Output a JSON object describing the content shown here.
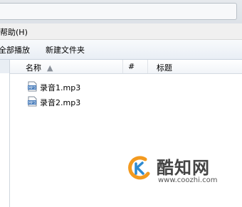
{
  "menubar": {
    "help_label": "帮助(H)"
  },
  "toolbar": {
    "play_all_label": "全部播放",
    "new_folder_label": "新建文件夹"
  },
  "columns": {
    "name_label": "名称",
    "number_label": "#",
    "title_label": "标题"
  },
  "files": [
    {
      "name": "录音1.mp3",
      "icon": "mp3-file-icon"
    },
    {
      "name": "录音2.mp3",
      "icon": "mp3-file-icon"
    }
  ],
  "watermark": {
    "brand": "酷知网",
    "url": "www.coozhi.com"
  },
  "colors": {
    "logo_orange": "#f39a1f",
    "logo_blue": "#2e8ad0"
  }
}
